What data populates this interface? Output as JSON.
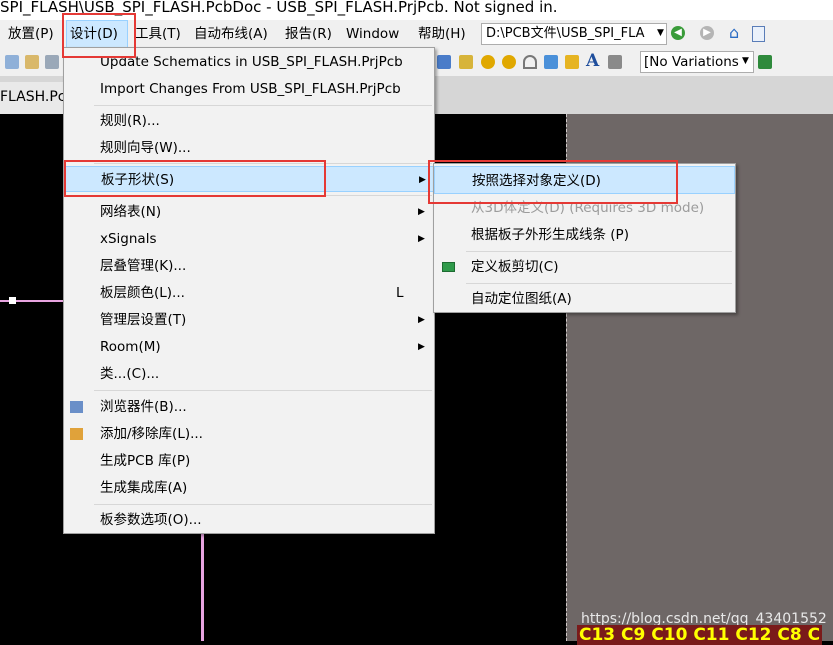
{
  "window": {
    "title": "SPI_FLASH\\USB_SPI_FLASH.PcbDoc - USB_SPI_FLASH.PrjPcb. Not signed in."
  },
  "menubar": {
    "items": [
      "放置(P)",
      "设计(D)",
      "工具(T)",
      "自动布线(A)",
      "报告(R)",
      "Window",
      "帮助(H)"
    ],
    "path": "D:\\PCB文件\\USB_SPI_FLA"
  },
  "toolbar": {
    "variations": "[No Variations"
  },
  "tabs": {
    "doc": "FLASH.Pcb"
  },
  "design_menu": {
    "items": [
      "Update Schematics in USB_SPI_FLASH.PrjPcb",
      "Import Changes From USB_SPI_FLASH.PrjPcb",
      "规则(R)...",
      "规则向导(W)...",
      "板子形状(S)",
      "网络表(N)",
      "xSignals",
      "层叠管理(K)...",
      "板层颜色(L)...",
      "管理层设置(T)",
      "Room(M)",
      "类...(C)...",
      "浏览器件(B)...",
      "添加/移除库(L)...",
      "生成PCB 库(P)",
      "生成集成库(A)",
      "板参数选项(O)..."
    ],
    "shortcut_board_layers": "L"
  },
  "board_shape_submenu": {
    "items": [
      "按照选择对象定义(D)",
      "从3D体定义(D) (Requires 3D mode)",
      "根据板子外形生成线条 (P)",
      "定义板剪切(C)",
      "自动定位图纸(A)"
    ]
  },
  "canvas": {
    "watermark": "https://blog.csdn.net/qq_43401552",
    "component_labels": "C13 C9 C10 C11 C12 C8 C"
  },
  "colors": {
    "highlight": "#cce8ff",
    "annotation": "#e53935",
    "canvas": "#000000",
    "board_outside": "#6e6766"
  }
}
